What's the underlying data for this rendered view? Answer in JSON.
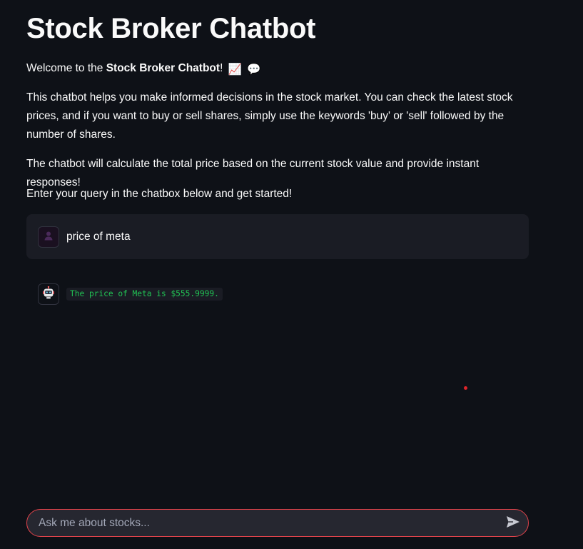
{
  "header": {
    "title": "Stock Broker Chatbot"
  },
  "intro": {
    "welcome_prefix": "Welcome to the ",
    "welcome_bold": "Stock Broker Chatbot",
    "welcome_suffix": "!",
    "welcome_emoji_1": "📈",
    "welcome_emoji_2": "💬",
    "description": "This chatbot helps you make informed decisions in the stock market. You can check the latest stock prices, and if you want to buy or sell shares, simply use the keywords 'buy' or 'sell' followed by the number of shares.",
    "calculation_note": "The chatbot will calculate the total price based on the current stock value and provide instant responses!",
    "cta": "Enter your query in the chatbox below and get started!"
  },
  "messages": [
    {
      "role": "user",
      "avatar_icon": "user-icon",
      "text": "price of meta"
    },
    {
      "role": "assistant",
      "avatar_icon": "robot-icon",
      "text": "The price of Meta is $555.9999."
    }
  ],
  "chat_input": {
    "placeholder": "Ask me about stocks...",
    "value": "",
    "send_icon": "send-icon"
  },
  "colors": {
    "background": "#0e1117",
    "message_background": "#1a1c24",
    "code_text": "#21c354",
    "input_border": "#e0434b",
    "input_background": "#262730"
  }
}
